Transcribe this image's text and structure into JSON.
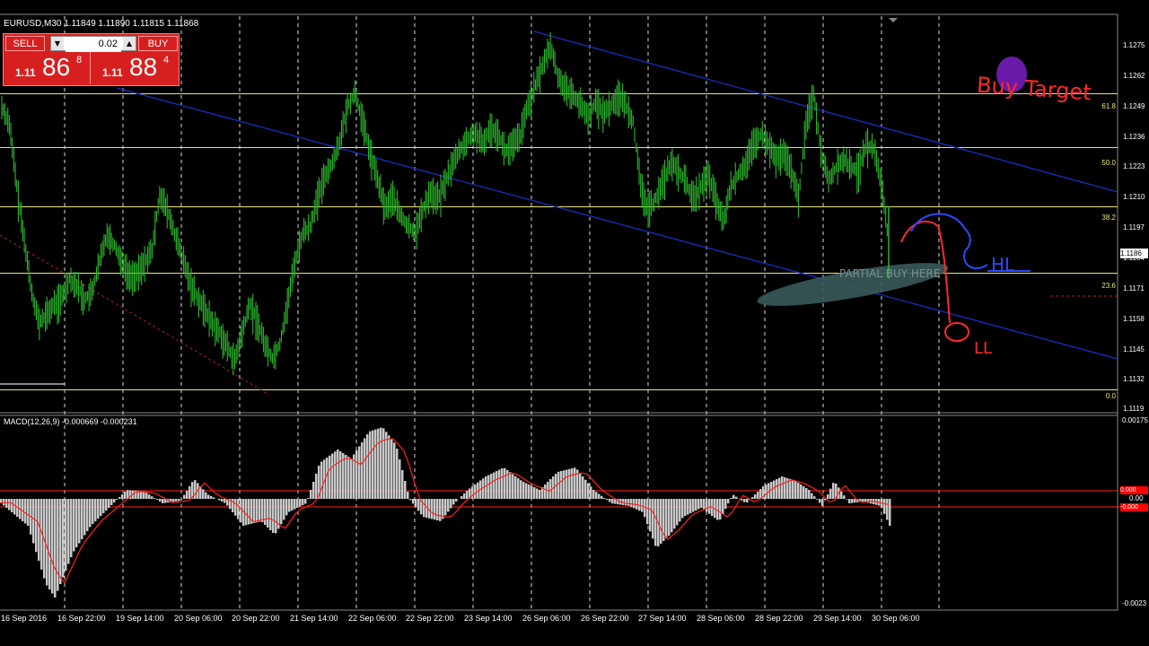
{
  "symbol_info": "EURUSD,M30  1.11849 1.11890 1.11815 1.11868",
  "trade_panel": {
    "sell_label": "SELL",
    "buy_label": "BUY",
    "lot_value": "0.02",
    "sell_price": {
      "prefix": "1.11",
      "big": "86",
      "sup": "8"
    },
    "buy_price": {
      "prefix": "1.11",
      "big": "88",
      "sup": "4"
    }
  },
  "price_axis": {
    "labels": [
      "1.1275",
      "1.1262",
      "1.1249",
      "1.1236",
      "1.1223",
      "1.1210",
      "1.1197",
      "1.1184",
      "1.1171",
      "1.1158",
      "1.1145",
      "1.1132",
      "1.1119"
    ],
    "current_price": "1.1186",
    "range": [
      1.1116,
      1.1282
    ]
  },
  "fib_levels": [
    {
      "label": "61.8",
      "price": 1.125
    },
    {
      "label": "50.0",
      "price": 1.1227
    },
    {
      "label": "38.2",
      "price": 1.1202
    },
    {
      "label": "23.6",
      "price": 1.11735
    },
    {
      "label": "0.0",
      "price": 1.1124
    }
  ],
  "time_axis": [
    "16 Sep 2016",
    "16 Sep 22:00",
    "19 Sep 14:00",
    "20 Sep 06:00",
    "20 Sep 22:00",
    "21 Sep 14:00",
    "22 Sep 06:00",
    "22 Sep 22:00",
    "23 Sep 14:00",
    "26 Sep 06:00",
    "26 Sep 22:00",
    "27 Sep 14:00",
    "28 Sep 06:00",
    "28 Sep 22:00",
    "29 Sep 14:00",
    "30 Sep 06:00"
  ],
  "macd": {
    "label": "MACD(12,26,9) -0.000669 -0.000231",
    "axis_labels": [
      "0.00175",
      "0.00",
      "-0.0023"
    ],
    "level_tags": [
      "0.000",
      "-0.000"
    ]
  },
  "annotations": {
    "buy_target": "Buy  Target",
    "partial_buy": "PARTIAL BUY  HERE",
    "hl": "HL",
    "ll": "LL"
  },
  "colors": {
    "candles": "#2bb52b",
    "fib": "#e6e67a",
    "channel": "#1c2cbf",
    "macd_hist": "#c8c8c8",
    "macd_signal": "#ff2020",
    "annotation_red": "#ff2a2a",
    "annotation_blue": "#2a4bff",
    "ellipse": "#3a5a5a"
  },
  "chart_data": {
    "type": "line",
    "title": "EURUSD,M30",
    "series": [
      {
        "name": "EURUSD",
        "values": [
          1.1244,
          1.1237,
          1.121,
          1.1187,
          1.1165,
          1.1152,
          1.1156,
          1.116,
          1.1163,
          1.1171,
          1.1168,
          1.1162,
          1.1165,
          1.1178,
          1.119,
          1.1185,
          1.1178,
          1.1172,
          1.1173,
          1.1178,
          1.1183,
          1.1207,
          1.12,
          1.119,
          1.118,
          1.117,
          1.1163,
          1.1158,
          1.1152,
          1.1148,
          1.1142,
          1.1136,
          1.1148,
          1.116,
          1.1153,
          1.1143,
          1.1137,
          1.1143,
          1.116,
          1.1178,
          1.119,
          1.1193,
          1.1205,
          1.1215,
          1.122,
          1.123,
          1.1244,
          1.125,
          1.1238,
          1.1225,
          1.1213,
          1.1201,
          1.1206,
          1.1198,
          1.1193,
          1.1191,
          1.12,
          1.1208,
          1.1205,
          1.1212,
          1.122,
          1.1226,
          1.123,
          1.1233,
          1.1228,
          1.1235,
          1.1233,
          1.1225,
          1.1228,
          1.1232,
          1.1245,
          1.1253,
          1.1262,
          1.127,
          1.1257,
          1.1252,
          1.1249,
          1.1245,
          1.124,
          1.1246,
          1.1242,
          1.1244,
          1.1249,
          1.1245,
          1.1238,
          1.121,
          1.12,
          1.1205,
          1.1213,
          1.122,
          1.1217,
          1.1212,
          1.1205,
          1.121,
          1.1215,
          1.1205,
          1.1195,
          1.121,
          1.1215,
          1.122,
          1.1228,
          1.1232,
          1.1228,
          1.1222,
          1.1224,
          1.1218,
          1.1205,
          1.1237,
          1.125,
          1.1225,
          1.1213,
          1.1218,
          1.1222,
          1.1218,
          1.1217,
          1.1228,
          1.1226,
          1.1212,
          1.1187
        ]
      }
    ],
    "ylim": [
      1.1116,
      1.1282
    ]
  }
}
